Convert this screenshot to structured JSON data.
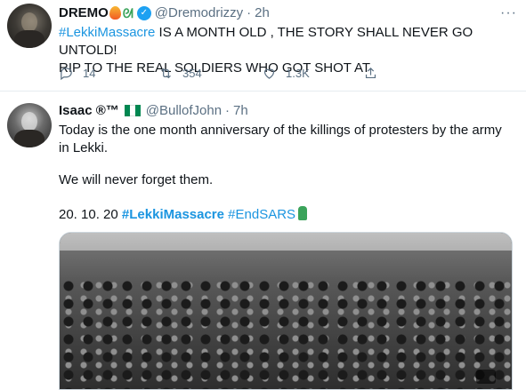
{
  "tweet1": {
    "name": "DREMO",
    "handle": "@Dremodrizzy",
    "dot": "·",
    "time": "2h",
    "more": "···",
    "text": {
      "hashtag": "#LekkiMassacre",
      "line1_rest": " IS A MONTH OLD , THE STORY SHALL NEVER GO UNTOLD!",
      "line2": "RIP TO THE REAL SOLDIERS WHO GOT SHOT AT"
    },
    "actions": {
      "replies": "14",
      "retweets": "354",
      "likes": "1.3K"
    },
    "icons": [
      "fire-icon",
      "dragon-icon",
      "verified-icon",
      "reply-icon",
      "retweet-icon",
      "like-icon",
      "share-icon"
    ]
  },
  "tweet2": {
    "name": "Isaac ®™",
    "handle": "@BullofJohn",
    "dot": "·",
    "time": "7h",
    "line1": "Today is the one month anniversary of the killings of protesters by the army",
    "line2": "in Lekki.",
    "line3": "We will never forget them.",
    "date_text": "20. 10. 20 ",
    "hashtag1": "#LekkiMassacre",
    "hashtag2": "#EndSARS",
    "icons": [
      "nigeria-flag-icon",
      "raised-fist-icon"
    ]
  },
  "colors": {
    "link": "#1b95e0",
    "secondary_text": "#5b7083",
    "verified": "#1da1f2"
  }
}
